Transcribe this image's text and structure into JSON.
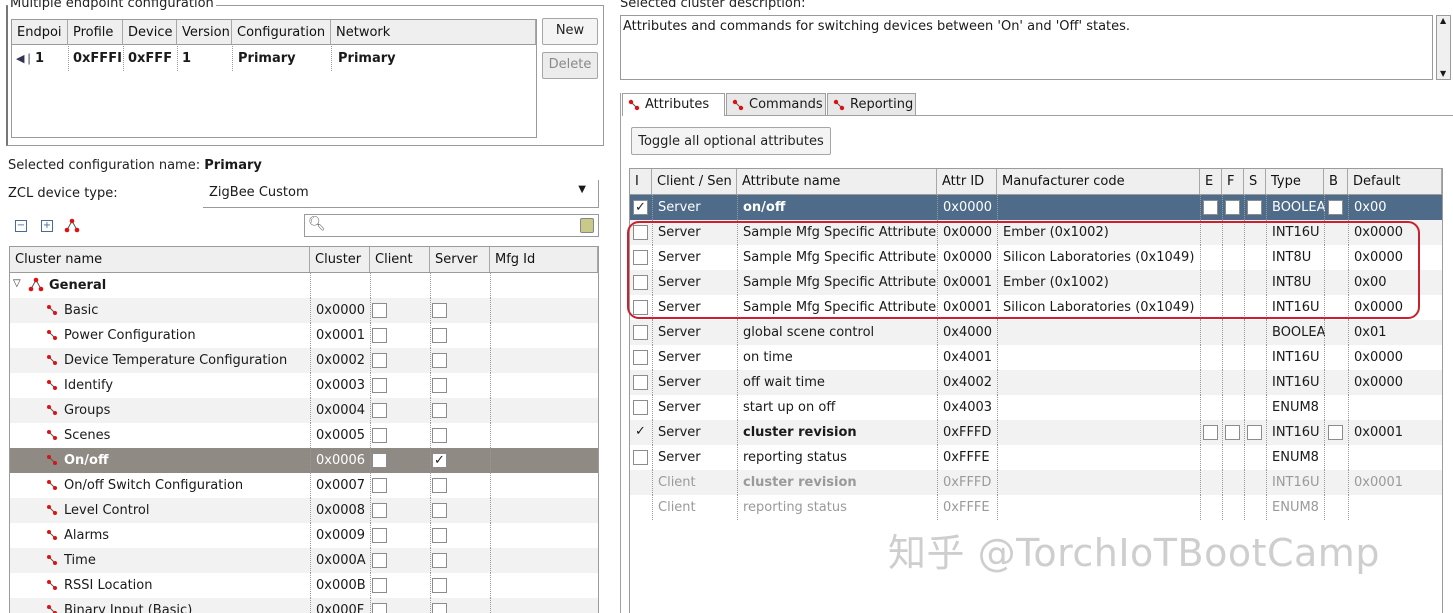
{
  "endpoint_panel": {
    "legend": "Multiple endpoint configuration",
    "columns": [
      "Endpoi",
      "Profile",
      "Device",
      "Version",
      "Configuration",
      "Network"
    ],
    "rows": [
      {
        "endpoint": "1",
        "profile": "0xFFFI",
        "device": "0xFFFI",
        "version": "1",
        "configuration": "Primary",
        "network": "Primary"
      }
    ],
    "new_label": "New",
    "delete_label": "Delete"
  },
  "selected_config": {
    "label": "Selected configuration name:",
    "value": "Primary"
  },
  "zcl_device": {
    "label": "ZCL device type:",
    "value": "ZigBee Custom"
  },
  "cluster_table": {
    "columns": [
      "Cluster name",
      "Cluster",
      "Client",
      "Server",
      "Mfg Id"
    ],
    "group": "General",
    "rows": [
      {
        "name": "Basic",
        "id": "0x0000",
        "client": false,
        "server": false
      },
      {
        "name": "Power Configuration",
        "id": "0x0001",
        "client": false,
        "server": false
      },
      {
        "name": "Device Temperature Configuration",
        "id": "0x0002",
        "client": false,
        "server": false
      },
      {
        "name": "Identify",
        "id": "0x0003",
        "client": false,
        "server": false
      },
      {
        "name": "Groups",
        "id": "0x0004",
        "client": false,
        "server": false
      },
      {
        "name": "Scenes",
        "id": "0x0005",
        "client": false,
        "server": false
      },
      {
        "name": "On/off",
        "id": "0x0006",
        "client": false,
        "server": true,
        "selected": true
      },
      {
        "name": "On/off Switch Configuration",
        "id": "0x0007",
        "client": false,
        "server": false
      },
      {
        "name": "Level Control",
        "id": "0x0008",
        "client": false,
        "server": false
      },
      {
        "name": "Alarms",
        "id": "0x0009",
        "client": false,
        "server": false
      },
      {
        "name": "Time",
        "id": "0x000A",
        "client": false,
        "server": false
      },
      {
        "name": "RSSI Location",
        "id": "0x000B",
        "client": false,
        "server": false
      },
      {
        "name": "Binary Input (Basic)",
        "id": "0x000F",
        "client": false,
        "server": false
      }
    ]
  },
  "cluster_desc": {
    "label": "Selected cluster description:",
    "text": "Attributes and commands for switching devices between 'On' and 'Off' states."
  },
  "tabs": [
    "Attributes",
    "Commands",
    "Reporting"
  ],
  "toggle_label": "Toggle all optional attributes",
  "attr_table": {
    "columns": [
      "I",
      "Client / Sen",
      "Attribute name",
      "Attr ID",
      "Manufacturer code",
      "E",
      "F",
      "S",
      "Type",
      "B",
      "Default"
    ],
    "rows": [
      {
        "checked": "✓",
        "side": "Server",
        "name": "on/off",
        "id": "0x0000",
        "mfg": "",
        "type": "BOOLEA",
        "def": "0x00",
        "style": "selected",
        "boxes": true
      },
      {
        "checked": "",
        "side": "Server",
        "name": "Sample Mfg Specific Attribute",
        "id": "0x0000",
        "mfg": "Ember (0x1002)",
        "type": "INT16U",
        "def": "0x0000",
        "style": ""
      },
      {
        "checked": "",
        "side": "Server",
        "name": "Sample Mfg Specific Attribute",
        "id": "0x0000",
        "mfg": "Silicon Laboratories (0x1049)",
        "type": "INT8U",
        "def": "0x0000",
        "style": ""
      },
      {
        "checked": "",
        "side": "Server",
        "name": "Sample Mfg Specific Attribute",
        "id": "0x0001",
        "mfg": "Ember (0x1002)",
        "type": "INT8U",
        "def": "0x00",
        "style": ""
      },
      {
        "checked": "",
        "side": "Server",
        "name": "Sample Mfg Specific Attribute",
        "id": "0x0001",
        "mfg": "Silicon Laboratories (0x1049)",
        "type": "INT16U",
        "def": "0x0000",
        "style": ""
      },
      {
        "checked": "",
        "side": "Server",
        "name": "global scene control",
        "id": "0x4000",
        "mfg": "",
        "type": "BOOLEA",
        "def": "0x01",
        "style": ""
      },
      {
        "checked": "",
        "side": "Server",
        "name": "on time",
        "id": "0x4001",
        "mfg": "",
        "type": "INT16U",
        "def": "0x0000",
        "style": ""
      },
      {
        "checked": "",
        "side": "Server",
        "name": "off wait time",
        "id": "0x4002",
        "mfg": "",
        "type": "INT16U",
        "def": "0x0000",
        "style": ""
      },
      {
        "checked": "",
        "side": "Server",
        "name": "start up on off",
        "id": "0x4003",
        "mfg": "",
        "type": "ENUM8",
        "def": "",
        "style": ""
      },
      {
        "checked": "✓",
        "side": "Server",
        "name": "cluster revision",
        "id": "0xFFFD",
        "mfg": "",
        "type": "INT16U",
        "def": "0x0001",
        "style": "bold",
        "boxes": true,
        "nocb": true
      },
      {
        "checked": "",
        "side": "Server",
        "name": "reporting status",
        "id": "0xFFFE",
        "mfg": "",
        "type": "ENUM8",
        "def": "",
        "style": ""
      },
      {
        "checked": "",
        "side": "Client",
        "name": "cluster revision",
        "id": "0xFFFD",
        "mfg": "",
        "type": "INT16U",
        "def": "0x0001",
        "style": "graybold",
        "nocb": true
      },
      {
        "checked": "",
        "side": "Client",
        "name": "reporting status",
        "id": "0xFFFE",
        "mfg": "",
        "type": "ENUM8",
        "def": "",
        "style": "gray",
        "nocb": true
      }
    ]
  },
  "watermark": "知乎 @TorchIoTBootCamp",
  "colors": {
    "highlight_red": "#cc1f2f",
    "selected_blue": "#4e6b89",
    "selected_gray": "#8f8a84"
  }
}
